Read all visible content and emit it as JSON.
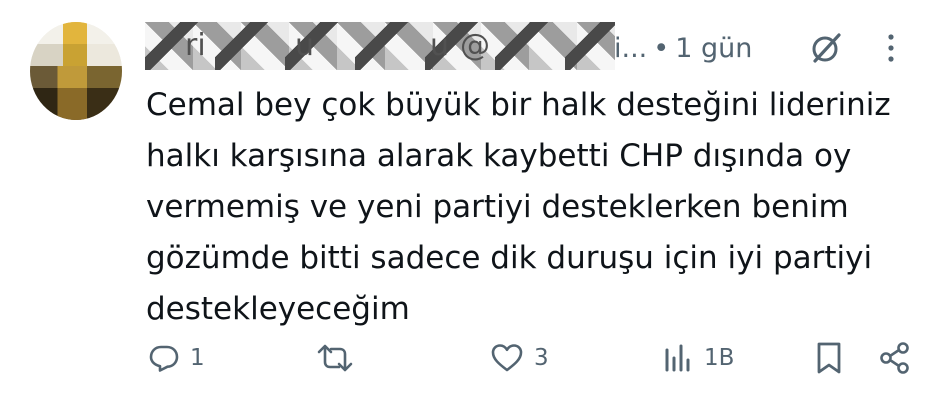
{
  "header": {
    "blurred_name_fragments": [
      "ri",
      "u",
      "u",
      "@"
    ],
    "handle_suffix": "i...",
    "separator": "•",
    "timestamp": "1 gün"
  },
  "tweet": {
    "text": "Cemal bey çok büyük bir halk desteğini lideriniz\nhalkı karşısına alarak kaybetti CHP dışında oy\nvermemiş ve yeni partiyi desteklerken benim\ngözümde bitti sadece dik duruşu için iyi partiyi\ndestekleyeceğim"
  },
  "actions": {
    "reply_count": "1",
    "retweet_count": "",
    "like_count": "3",
    "views_count": "1B"
  },
  "colors": {
    "text": "#0f1419",
    "muted": "#536471",
    "background": "#ffffff"
  },
  "icons": [
    "grok-icon",
    "more-icon",
    "reply-icon",
    "retweet-icon",
    "like-icon",
    "views-icon",
    "bookmark-icon",
    "share-icon"
  ]
}
